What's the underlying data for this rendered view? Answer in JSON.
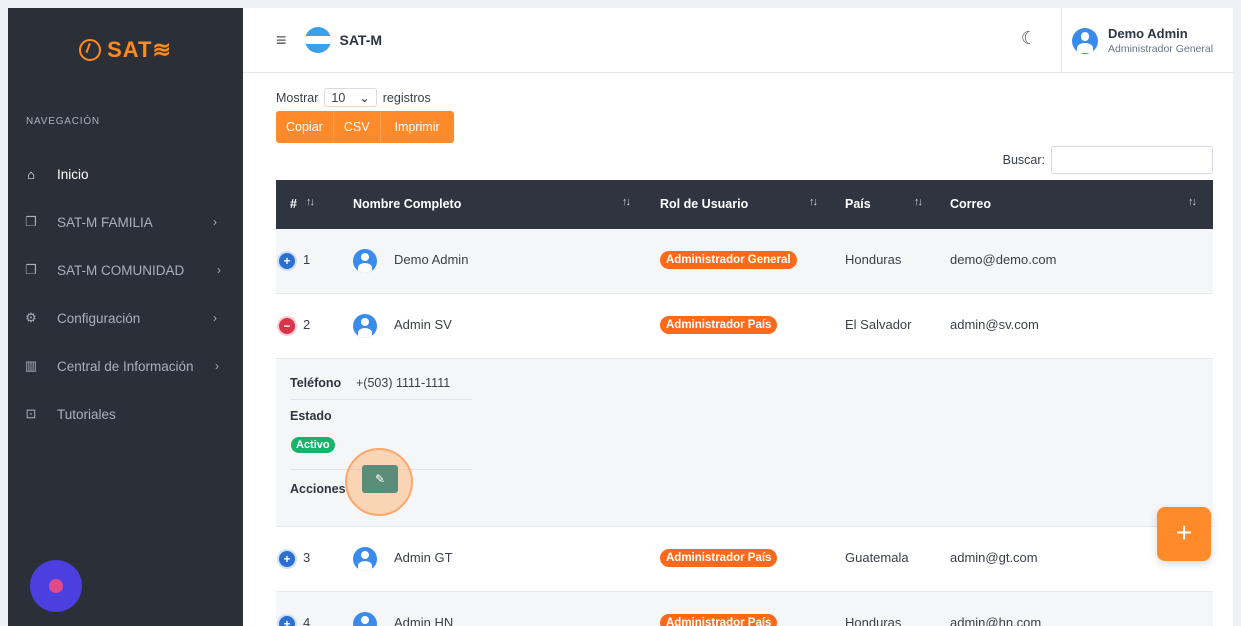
{
  "sidebar": {
    "logo_text": "SAT≋",
    "nav_header": "NAVEGACIÓN",
    "items": [
      {
        "label": "Inicio",
        "icon": "home-icon",
        "chevron": ""
      },
      {
        "label": "SAT-M FAMILIA",
        "icon": "copy-icon",
        "chevron": "›"
      },
      {
        "label": "SAT-M COMUNIDAD",
        "icon": "copy-icon",
        "chevron": "›"
      },
      {
        "label": "Configuración",
        "icon": "gear-icon",
        "chevron": "›"
      },
      {
        "label": "Central de Información",
        "icon": "bar-chart-icon",
        "chevron": "›"
      },
      {
        "label": "Tutoriales",
        "icon": "presentation-icon",
        "chevron": ""
      }
    ]
  },
  "topbar": {
    "app_title": "SAT-M",
    "user_name": "Demo Admin",
    "user_role": "Administrador General"
  },
  "controls": {
    "show_label": "Mostrar",
    "length_value": "10",
    "records_label": "registros",
    "buttons": [
      "Copiar",
      "CSV",
      "Imprimir"
    ],
    "search_label": "Buscar:",
    "search_value": ""
  },
  "table": {
    "columns": [
      "#",
      "Nombre Completo",
      "Rol de Usuario",
      "País",
      "Correo"
    ],
    "rows": [
      {
        "num": "1",
        "name": "Demo Admin",
        "role": "Administrador General",
        "country": "Honduras",
        "email": "demo@demo.com",
        "toggle": "+"
      },
      {
        "num": "2",
        "name": "Admin SV",
        "role": "Administrador País",
        "country": "El Salvador",
        "email": "admin@sv.com",
        "toggle": "−"
      },
      {
        "num": "3",
        "name": "Admin GT",
        "role": "Administrador País",
        "country": "Guatemala",
        "email": "admin@gt.com",
        "toggle": "+"
      },
      {
        "num": "4",
        "name": "Admin HN",
        "role": "Administrador País",
        "country": "Honduras",
        "email": "admin@hn.com",
        "toggle": "+"
      }
    ],
    "detail": {
      "phone_label": "Teléfono",
      "phone_value": "+(503) 1111-1111",
      "status_label": "Estado",
      "status_value": "Activo",
      "actions_label": "Acciones"
    }
  },
  "fab_label": "+",
  "colors": {
    "accent": "#ff8a2a",
    "sidebar": "#2b3038",
    "header": "#2e3540",
    "active": "#18b26b"
  }
}
